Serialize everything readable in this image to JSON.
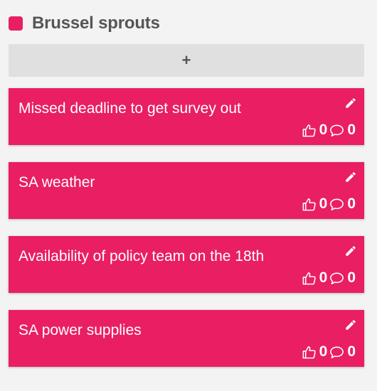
{
  "column": {
    "title": "Brussel sprouts",
    "color": "#e91e63",
    "add_label": "+"
  },
  "cards": [
    {
      "text": "Missed deadline to get survey out",
      "likes": "0",
      "comments": "0"
    },
    {
      "text": "SA weather",
      "likes": "0",
      "comments": "0"
    },
    {
      "text": "Availability of policy team on the 18th",
      "likes": "0",
      "comments": "0"
    },
    {
      "text": "SA power supplies",
      "likes": "0",
      "comments": "0"
    }
  ],
  "icons": {
    "edit": "pencil-icon",
    "like": "thumbs-up-icon",
    "comment": "comment-icon"
  }
}
